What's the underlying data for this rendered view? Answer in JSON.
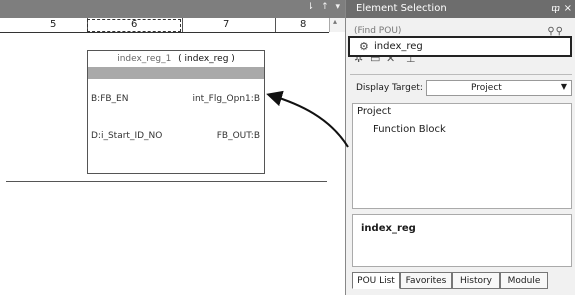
{
  "editor": {
    "topbar_buttons": "⇂ ↑ ▾",
    "columns": [
      "5",
      "6",
      "7",
      "8"
    ],
    "scroll_top": "▴",
    "function_block": {
      "instance": "index_reg_1",
      "type": "( index_reg )",
      "inputs": [
        "B:FB_EN",
        "D:i_Start_ID_NO"
      ],
      "outputs": [
        "int_Flg_Opn1:B",
        "FB_OUT:B"
      ]
    }
  },
  "panel": {
    "title": "Element Selection",
    "pin": "ⴔ",
    "close": "×",
    "find_placeholder": "(Find POU)",
    "find_icons": "⚲⚲",
    "toolbar_icons": [
      "✲",
      "▭",
      "✕",
      "⊥"
    ],
    "display_target_label": "Display Target:",
    "display_target_value": "Project",
    "tree": {
      "root": "Project",
      "child": "Function Block",
      "selected": "index_reg"
    },
    "detail_name": "index_reg",
    "tabs": [
      "POU List",
      "Favorites",
      "History",
      "Module"
    ]
  },
  "colors": {
    "title_bar": "#6d6d6d",
    "editor_bar": "#7e7e7e",
    "fb_band": "#a9a9a9"
  }
}
